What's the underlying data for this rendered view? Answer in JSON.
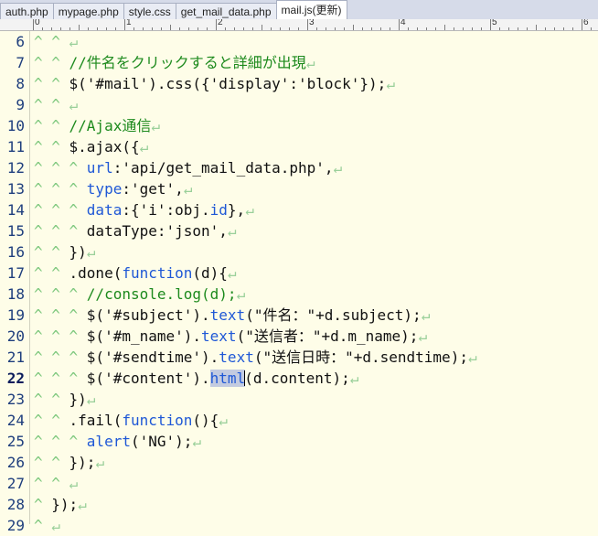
{
  "tabs": [
    {
      "label": "auth.php",
      "active": false
    },
    {
      "label": "mypage.php",
      "active": false
    },
    {
      "label": "style.css",
      "active": false
    },
    {
      "label": "get_mail_data.php",
      "active": false
    },
    {
      "label": "mail.js(更新)",
      "active": true
    }
  ],
  "ruler": {
    "numbers": [
      "0",
      "1",
      "2",
      "3",
      "4",
      "5",
      "6"
    ]
  },
  "editor": {
    "current_line": "22",
    "lines": [
      {
        "num": "6",
        "indent": "^ ^ ",
        "parts": []
      },
      {
        "num": "7",
        "indent": "^ ^ ",
        "parts": [
          {
            "t": "//件名をクリックすると詳細が出現",
            "c": "cmt"
          }
        ]
      },
      {
        "num": "8",
        "indent": "^ ^ ",
        "parts": [
          {
            "t": "$('#mail').css({'display':'block'});",
            "c": ""
          }
        ]
      },
      {
        "num": "9",
        "indent": "^ ^ ",
        "parts": []
      },
      {
        "num": "10",
        "indent": "^ ^ ",
        "parts": [
          {
            "t": "//Ajax通信",
            "c": "cmt"
          }
        ]
      },
      {
        "num": "11",
        "indent": "^ ^ ",
        "parts": [
          {
            "t": "$.ajax({",
            "c": ""
          }
        ]
      },
      {
        "num": "12",
        "indent": "^ ^ ^ ",
        "parts": [
          {
            "t": "url",
            "c": "kw"
          },
          {
            "t": ":'api/get_mail_data.php',",
            "c": ""
          }
        ]
      },
      {
        "num": "13",
        "indent": "^ ^ ^ ",
        "parts": [
          {
            "t": "type",
            "c": "kw"
          },
          {
            "t": ":'get',",
            "c": ""
          }
        ]
      },
      {
        "num": "14",
        "indent": "^ ^ ^ ",
        "parts": [
          {
            "t": "data",
            "c": "kw"
          },
          {
            "t": ":{'i':obj.",
            "c": ""
          },
          {
            "t": "id",
            "c": "kw"
          },
          {
            "t": "},",
            "c": ""
          }
        ]
      },
      {
        "num": "15",
        "indent": "^ ^ ^ ",
        "parts": [
          {
            "t": "dataType:'json',",
            "c": ""
          }
        ]
      },
      {
        "num": "16",
        "indent": "^ ^ ",
        "parts": [
          {
            "t": "})",
            "c": ""
          }
        ]
      },
      {
        "num": "17",
        "indent": "^ ^ ",
        "parts": [
          {
            "t": ".done(",
            "c": ""
          },
          {
            "t": "function",
            "c": "kw"
          },
          {
            "t": "(d){",
            "c": ""
          }
        ]
      },
      {
        "num": "18",
        "indent": "^ ^ ^ ",
        "parts": [
          {
            "t": "//console.log(d);",
            "c": "cmt"
          }
        ]
      },
      {
        "num": "19",
        "indent": "^ ^ ^ ",
        "parts": [
          {
            "t": "$('#subject').",
            "c": ""
          },
          {
            "t": "text",
            "c": "kw"
          },
          {
            "t": "(\"件名：\"+d.subject);",
            "c": ""
          }
        ]
      },
      {
        "num": "20",
        "indent": "^ ^ ^ ",
        "parts": [
          {
            "t": "$('#m_name').",
            "c": ""
          },
          {
            "t": "text",
            "c": "kw"
          },
          {
            "t": "(\"送信者：\"+d.m_name);",
            "c": ""
          }
        ]
      },
      {
        "num": "21",
        "indent": "^ ^ ^ ",
        "parts": [
          {
            "t": "$('#sendtime').",
            "c": ""
          },
          {
            "t": "text",
            "c": "kw"
          },
          {
            "t": "(\"送信日時：\"+d.sendtime);",
            "c": ""
          }
        ]
      },
      {
        "num": "22",
        "indent": "^ ^ ^ ",
        "parts": [
          {
            "t": "$('#content').",
            "c": ""
          },
          {
            "t": "html",
            "c": "kw hl"
          },
          {
            "t": "|",
            "c": "caret"
          },
          {
            "t": "(d.content);",
            "c": ""
          }
        ]
      },
      {
        "num": "23",
        "indent": "^ ^ ",
        "parts": [
          {
            "t": "})",
            "c": ""
          }
        ]
      },
      {
        "num": "24",
        "indent": "^ ^ ",
        "parts": [
          {
            "t": ".fail(",
            "c": ""
          },
          {
            "t": "function",
            "c": "kw"
          },
          {
            "t": "(){",
            "c": ""
          }
        ]
      },
      {
        "num": "25",
        "indent": "^ ^ ^ ",
        "parts": [
          {
            "t": "alert",
            "c": "kw"
          },
          {
            "t": "('NG');",
            "c": ""
          }
        ]
      },
      {
        "num": "26",
        "indent": "^ ^ ",
        "parts": [
          {
            "t": "});",
            "c": ""
          }
        ]
      },
      {
        "num": "27",
        "indent": "^ ^ ",
        "parts": []
      },
      {
        "num": "28",
        "indent": "^ ",
        "parts": [
          {
            "t": "});",
            "c": ""
          }
        ]
      },
      {
        "num": "29",
        "indent": "^ ",
        "parts": []
      }
    ],
    "return_mark": "↵"
  }
}
